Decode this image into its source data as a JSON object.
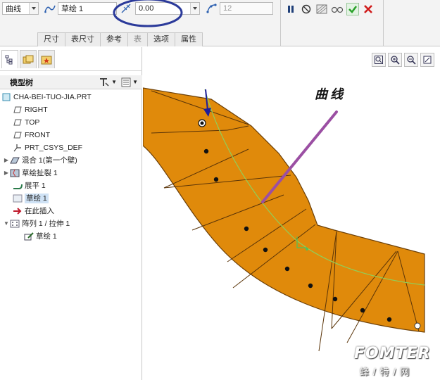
{
  "toolbar": {
    "type_combo": "曲线",
    "sketch_combo": "草绘 1",
    "value_combo": "0.00",
    "count_field": "12",
    "tabs": [
      "尺寸",
      "表尺寸",
      "参考",
      "表",
      "选项",
      "属性"
    ]
  },
  "left_panel": {
    "tree_title": "模型树",
    "items": [
      {
        "label": "CHA-BEI-TUO-JIA.PRT"
      },
      {
        "label": "RIGHT"
      },
      {
        "label": "TOP"
      },
      {
        "label": "FRONT"
      },
      {
        "label": "PRT_CSYS_DEF"
      },
      {
        "label": "混合 1(第一个壁)"
      },
      {
        "label": "草绘扯裂 1"
      },
      {
        "label": "展平 1"
      },
      {
        "label": "草绘 1"
      },
      {
        "label": "在此插入"
      },
      {
        "label": "阵列 1 / 拉伸 1"
      },
      {
        "label": "草绘 1"
      }
    ]
  },
  "graphics": {
    "annotation": "曲线",
    "watermark_brand": "FOMTER",
    "watermark_sub": "蜂/特/网"
  },
  "colors": {
    "part_fill": "#e08a0b",
    "curve": "#8fcf5a",
    "annotation_line": "#9b4fa3",
    "callout_circle": "#2b3a9a",
    "confirm": "#2aa22a",
    "cancel": "#d01a1a"
  }
}
